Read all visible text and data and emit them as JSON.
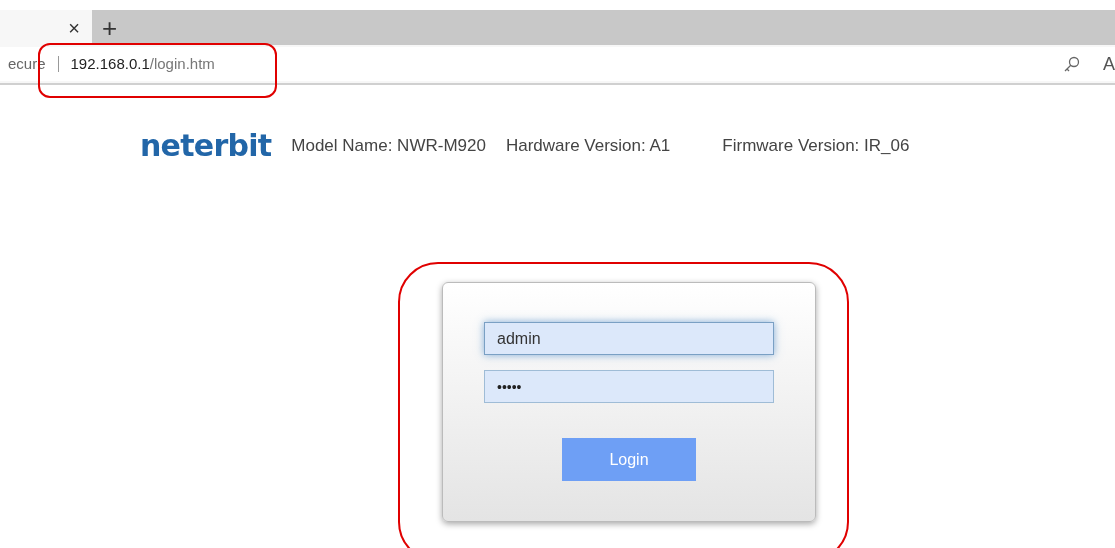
{
  "browser": {
    "tab_close": "×",
    "new_tab": "+",
    "security_text": "ecure",
    "url_host": "192.168.0.1",
    "url_path": "/login.htm",
    "reader_label": "A"
  },
  "header": {
    "logo": "neterbit",
    "model": "Model Name: NWR-M920",
    "hardware": "Hardware Version: A1",
    "firmware": "Firmware Version: IR_06"
  },
  "login": {
    "username": "admin",
    "password": "•••••",
    "button": "Login"
  }
}
